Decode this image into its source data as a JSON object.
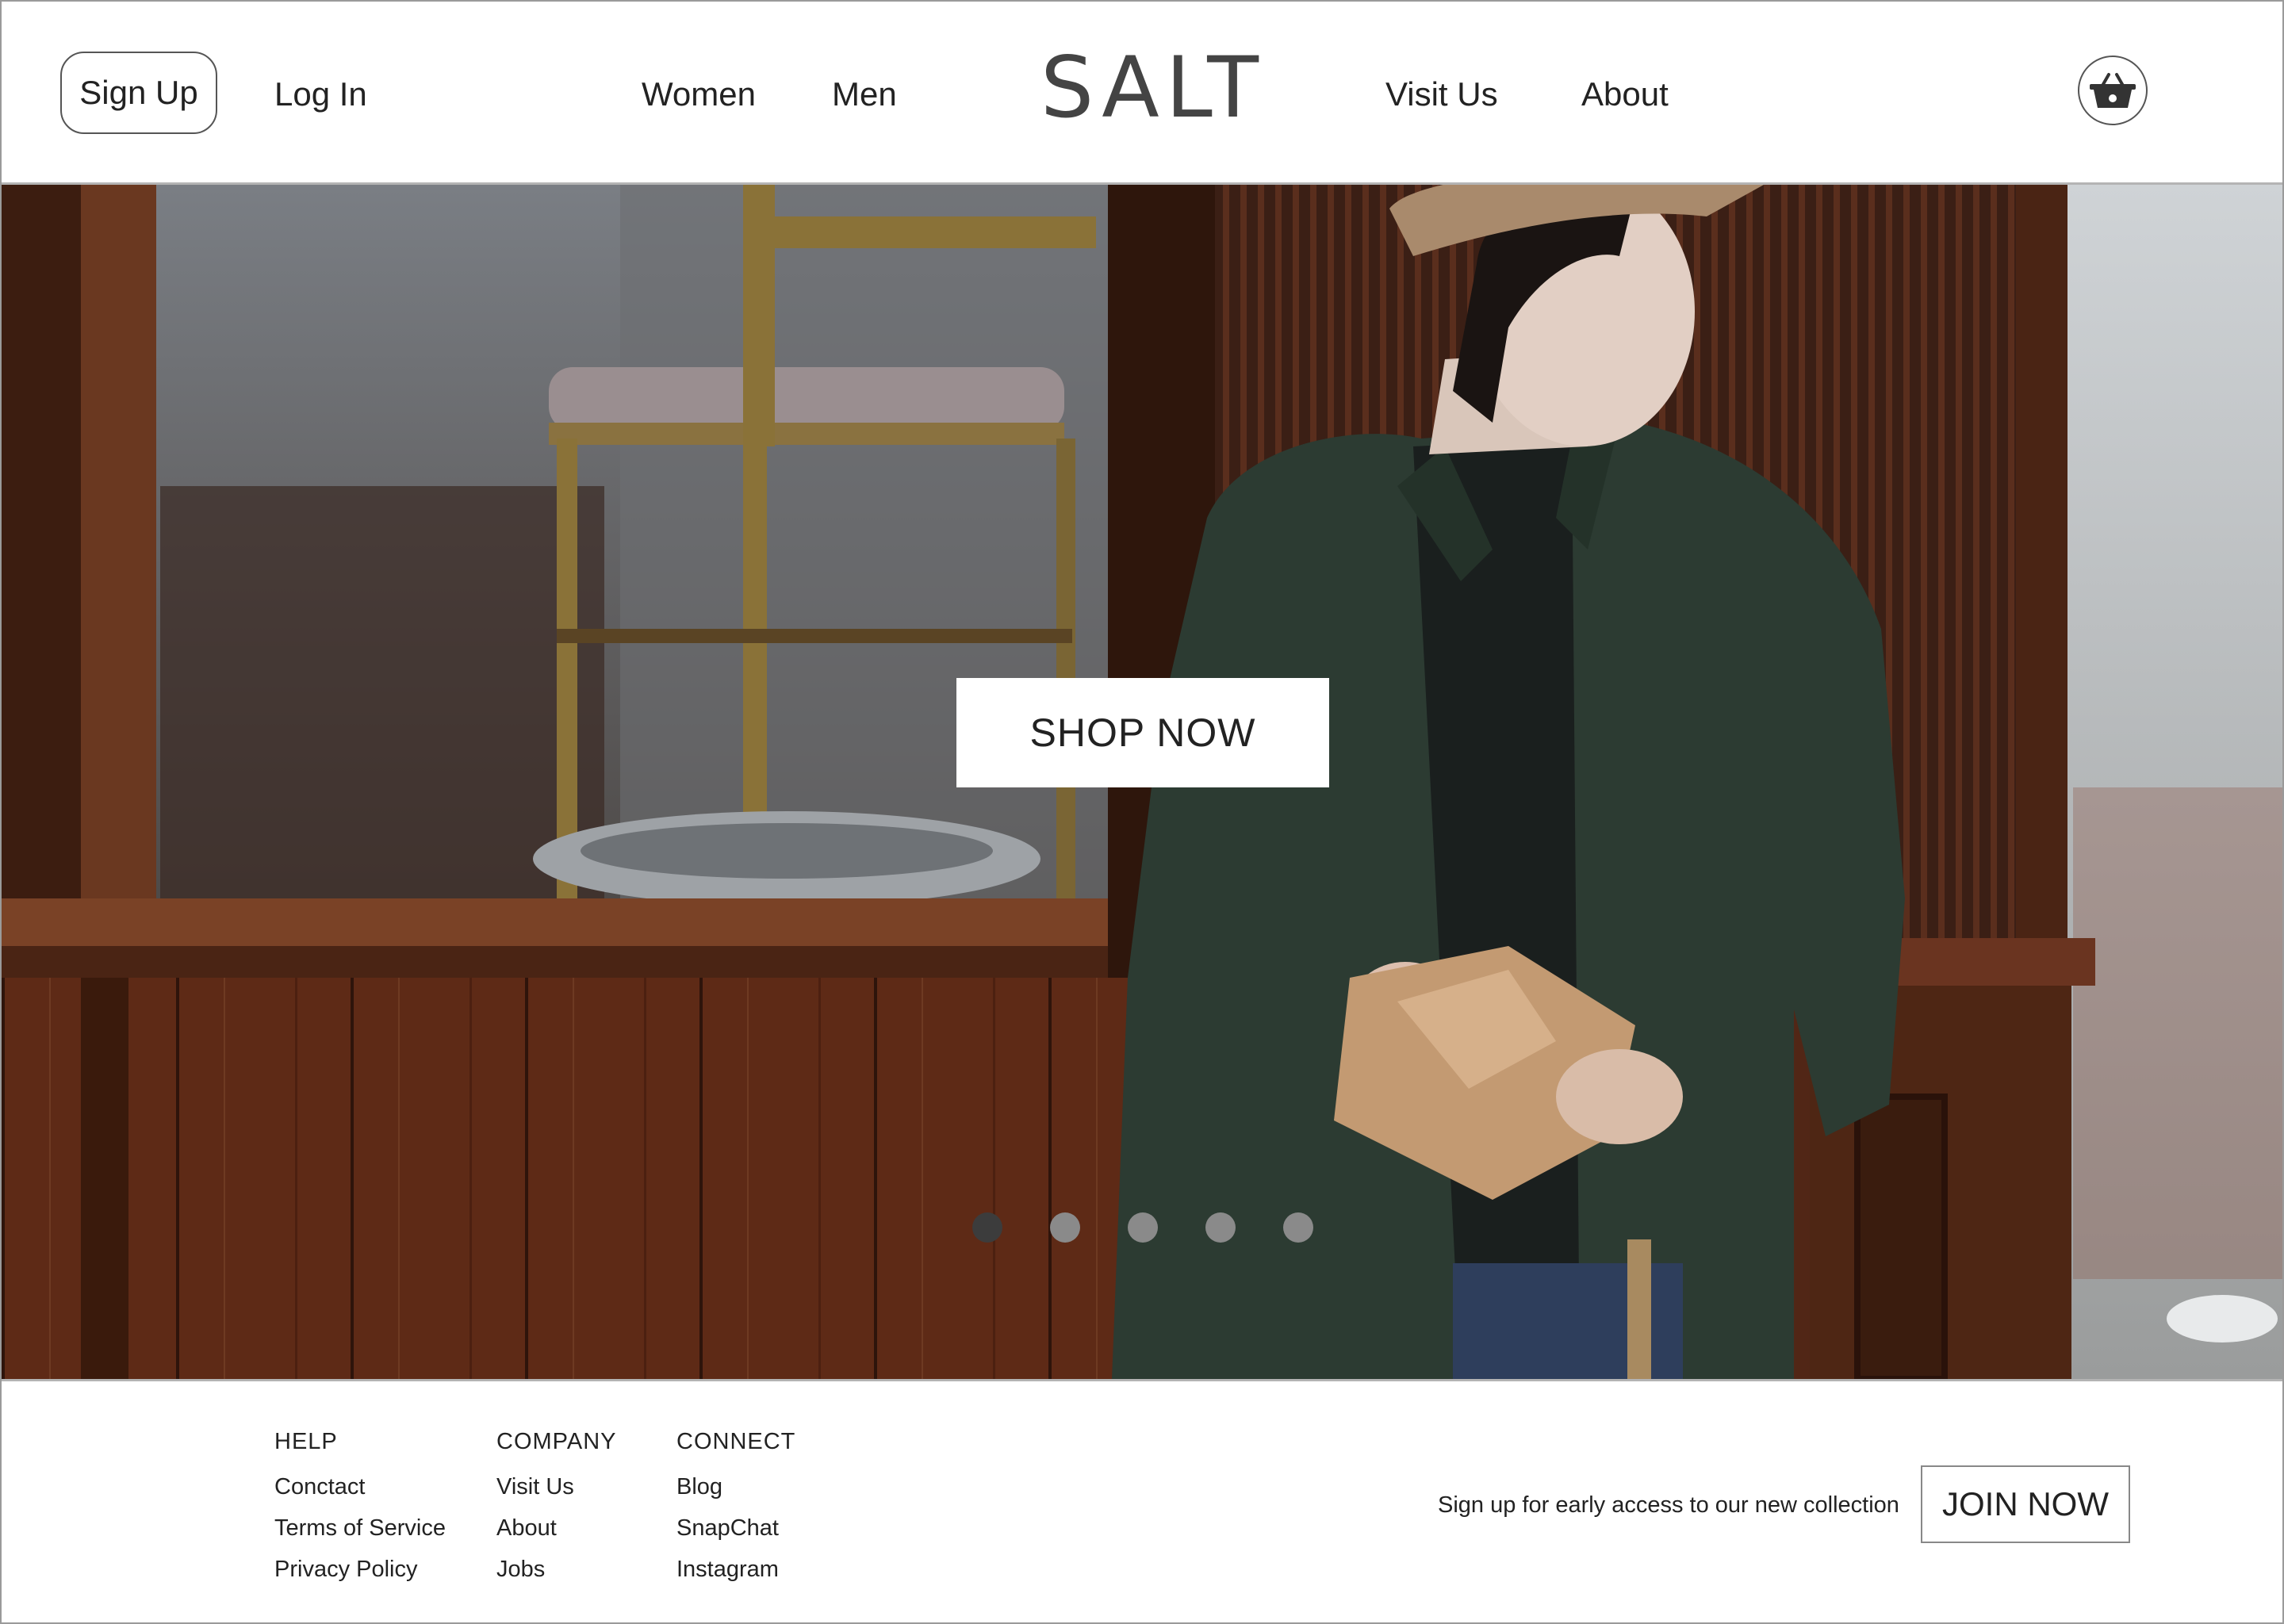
{
  "header": {
    "signup_label": "Sign Up",
    "login_label": "Log In",
    "nav": [
      "Women",
      "Men",
      "Visit Us",
      "About"
    ],
    "logo": "SALT",
    "cart_icon": "basket-icon"
  },
  "hero": {
    "cta_label": "SHOP NOW",
    "carousel": {
      "count": 5,
      "active_index": 0
    }
  },
  "footer": {
    "columns": [
      {
        "title": "HELP",
        "links": [
          "Conctact",
          "Terms of Service",
          "Privacy Policy"
        ]
      },
      {
        "title": "COMPANY",
        "links": [
          "Visit Us",
          "About",
          "Jobs"
        ]
      },
      {
        "title": "CONNECT",
        "links": [
          "Blog",
          "SnapChat",
          "Instagram"
        ]
      }
    ],
    "signup_text": "Sign up for early access to our new collection",
    "join_label": "JOIN NOW"
  },
  "colors": {
    "accent": "#222222",
    "border": "#b4b4b4",
    "dot_active": "#3c3c3c",
    "dot_inactive": "#8a8a8a"
  }
}
